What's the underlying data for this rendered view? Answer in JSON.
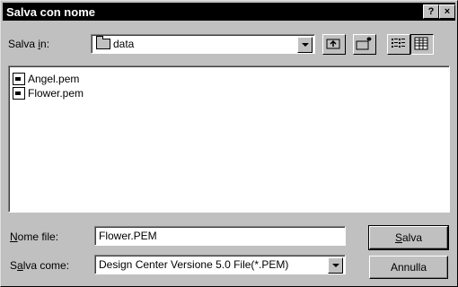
{
  "window": {
    "title": "Salva con nome",
    "help_label": "?",
    "close_label": "×"
  },
  "save_in": {
    "label_prefix": "Salva ",
    "label_accel": "i",
    "label_suffix": "n:",
    "folder": "data"
  },
  "files": [
    {
      "name": "Angel.pem"
    },
    {
      "name": "Flower.pem"
    }
  ],
  "filename": {
    "label_accel": "N",
    "label_rest": "ome file:",
    "value": "Flower.PEM"
  },
  "filetype": {
    "label_prefix": "S",
    "label_accel": "a",
    "label_rest": "lva come:",
    "value": "Design Center Versione 5.0 File(*.PEM)"
  },
  "buttons": {
    "save_accel": "S",
    "save_rest": "alva",
    "cancel": "Annulla"
  }
}
